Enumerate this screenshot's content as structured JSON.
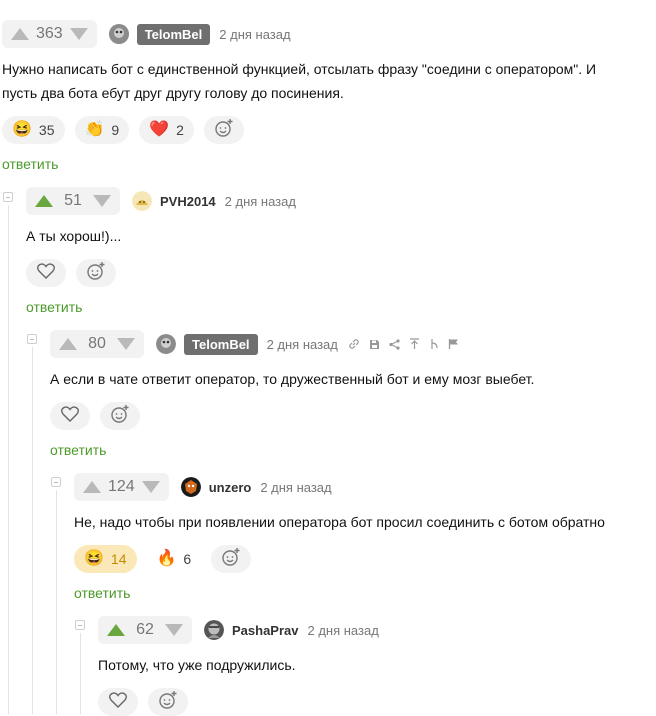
{
  "comments": [
    {
      "votes": "363",
      "user": "TelomBel",
      "time": "2 дня назад",
      "text": "Нужно написать бот с единственной функцией, отсылать фразу \"соедини с оператором\". И пусть два бота ебут друг другу голову до посинения.",
      "reactions": [
        {
          "emoji": "😆",
          "count": "35"
        },
        {
          "emoji": "👏",
          "count": "9"
        },
        {
          "emoji": "❤️",
          "count": "2"
        }
      ],
      "reply": "ответить"
    },
    {
      "votes": "51",
      "user": "PVH2014",
      "time": "2 дня назад",
      "text": "А ты хорош!)...",
      "reply": "ответить"
    },
    {
      "votes": "80",
      "user": "TelomBel",
      "time": "2 дня назад",
      "text": "А если в чате ответит оператор, то дружественный бот и ему мозг выебет.",
      "reply": "ответить"
    },
    {
      "votes": "124",
      "user": "unzero",
      "time": "2 дня назад",
      "text": "Не, надо чтобы при появлении оператора бот просил соединить с ботом обратно",
      "reactions": [
        {
          "emoji": "😆",
          "count": "14"
        },
        {
          "emoji": "🔥",
          "count": "6"
        }
      ],
      "reply": "ответить"
    },
    {
      "votes": "62",
      "user": "PashaPrav",
      "time": "2 дня назад",
      "text": "Потому, что уже подружились."
    }
  ],
  "colors": {
    "accent": "#4c9a2a",
    "upvoted": "#6aa83f",
    "badge": "#6f6f6f"
  },
  "icons": [
    "arrow-up-icon",
    "arrow-down-icon",
    "heart-icon",
    "add-reaction-icon",
    "link-icon",
    "save-icon",
    "share-icon",
    "pin-icon",
    "branch-icon",
    "flag-icon"
  ]
}
